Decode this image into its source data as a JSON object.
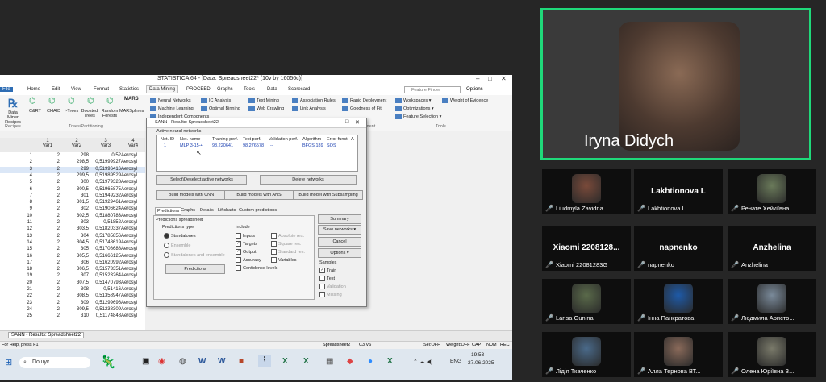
{
  "app": {
    "title": "STATISTICA 64 - [Data: Spreadsheet22* (10v by 16056c)]",
    "search_placeholder": "Feature Finder",
    "options_label": "Options"
  },
  "menu_tabs": [
    "File",
    "Home",
    "Edit",
    "View",
    "Format",
    "Statistics",
    "Data Mining",
    "PROCEED",
    "Graphs",
    "Tools",
    "Data",
    "Scorecard"
  ],
  "ribbon": {
    "recipes": {
      "label": "Data Miner Recipes",
      "group": "Recipes"
    },
    "trees": {
      "items": [
        "C&RT",
        "CHAID",
        "I-Trees",
        "Boosted Trees",
        "Random Forests",
        "MARSplines"
      ],
      "group": "Trees/Partitioning"
    },
    "col1": [
      "Neural Networks",
      "Machine Learning",
      "Independent Components"
    ],
    "col2": [
      "IC Analysis",
      "Optimal Binning"
    ],
    "col3": [
      "Text Mining",
      "Web Crawling"
    ],
    "col4": [
      "Association Rules",
      "Link Analysis"
    ],
    "col5": [
      "Rapid Deployment",
      "Goodness of Fit"
    ],
    "col6": [
      "Workspaces",
      "Optimizations",
      "Feature Selection"
    ],
    "col7": [
      "Weight of Evidence"
    ],
    "group_tools": "Tools",
    "group_ment": "ment"
  },
  "sheet": {
    "headers": [
      {
        "n": "1",
        "v": "Var1"
      },
      {
        "n": "2",
        "v": "Var2"
      },
      {
        "n": "3",
        "v": "Var3"
      },
      {
        "n": "4",
        "v": "Var4"
      }
    ],
    "rows": [
      [
        "1",
        "2",
        "298",
        "0,52",
        "Aerosyl"
      ],
      [
        "2",
        "2",
        "298,5",
        "0,51999927",
        "Aerosyl"
      ],
      [
        "3",
        "2",
        "299",
        "0,51996416",
        "Aerosyl"
      ],
      [
        "4",
        "2",
        "299,5",
        "0,51989529",
        "Aerosyl"
      ],
      [
        "5",
        "2",
        "300",
        "0,51979328",
        "Aerosyl"
      ],
      [
        "6",
        "2",
        "300,5",
        "0,51965875",
        "Aerosyl"
      ],
      [
        "7",
        "2",
        "301",
        "0,51949232",
        "Aerosyl"
      ],
      [
        "8",
        "2",
        "301,5",
        "0,51929461",
        "Aerosyl"
      ],
      [
        "9",
        "2",
        "302",
        "0,51906624",
        "Aerosyl"
      ],
      [
        "10",
        "2",
        "302,5",
        "0,51880783",
        "Aerosyl"
      ],
      [
        "11",
        "2",
        "303",
        "0,51852",
        "Aerosyl"
      ],
      [
        "12",
        "2",
        "303,5",
        "0,51820337",
        "Aerosyl"
      ],
      [
        "13",
        "2",
        "304",
        "0,51785856",
        "Aerosyl"
      ],
      [
        "14",
        "2",
        "304,5",
        "0,51748619",
        "Aerosyl"
      ],
      [
        "15",
        "2",
        "305",
        "0,51708688",
        "Aerosyl"
      ],
      [
        "16",
        "2",
        "305,5",
        "0,51666125",
        "Aerosyl"
      ],
      [
        "17",
        "2",
        "306",
        "0,51620992",
        "Aerosyl"
      ],
      [
        "18",
        "2",
        "306,5",
        "0,51573351",
        "Aerosyl"
      ],
      [
        "19",
        "2",
        "307",
        "0,51523264",
        "Aerosyl"
      ],
      [
        "20",
        "2",
        "307,5",
        "0,51470793",
        "Aerosyl"
      ],
      [
        "21",
        "2",
        "308",
        "0,51416",
        "Aerosyl"
      ],
      [
        "22",
        "2",
        "308,5",
        "0,51358947",
        "Aerosyl"
      ],
      [
        "23",
        "2",
        "309",
        "0,51299696",
        "Aerosyl"
      ],
      [
        "24",
        "2",
        "309,5",
        "0,51238309",
        "Aerosyl"
      ],
      [
        "25",
        "2",
        "310",
        "0,51174848",
        "Aerosyl"
      ]
    ]
  },
  "dialog": {
    "title": "SANN - Results: Spreadsheet22",
    "section": "Active neural networks",
    "table_headers": [
      "Net. ID",
      "Net. name",
      "Training perf.",
      "Test perf.",
      "Validation perf.",
      "Algorithm",
      "Error funct.",
      "A"
    ],
    "row": [
      "1",
      "MLP 3-15-4",
      "98,220641",
      "98,276578",
      "--",
      "BFGS 189",
      "SOS"
    ],
    "select_btn": "Select\\Deselect active networks",
    "delete_btn": "Delete networks",
    "build_cnn": "Build models with CNN",
    "build_ans": "Build  models with ANS",
    "build_sub": "Build model with Subsampling",
    "tabs": [
      "Predictions",
      "Graphs",
      "Details",
      "Liftcharts",
      "Custom predictions"
    ],
    "pred_spreadsheet": "Predictions spreadsheet",
    "pred_type": "Predictions type",
    "radios": [
      "Standalones",
      "Ensemble",
      "Standalones and ensemble"
    ],
    "include": "Include",
    "inc_left": [
      "Inputs",
      "Targets",
      "Output",
      "Accuracy",
      "Confidence levels"
    ],
    "inc_right": [
      "Absolute res.",
      "Square res.",
      "Standard res.",
      "Variables"
    ],
    "pred_btn": "Predictions",
    "summary_btn": "Summary",
    "save_btn": "Save networks",
    "cancel_btn": "Cancel",
    "options_btn": "Options",
    "samples": "Samples",
    "samples_list": [
      "Train",
      "Test",
      "Validation",
      "Missing"
    ]
  },
  "statusbar": {
    "help": "For Help, press F1",
    "doc": "SANN - Results: Spreadsheet22",
    "cells": [
      "Spreadsheet2",
      "C3,V6",
      "Sel:OFF",
      "Weight:OFF",
      "CAP",
      "NUM",
      "REC"
    ]
  },
  "taskbar": {
    "search": "Пошук",
    "time": "19:53",
    "date": "27.06.2025",
    "lang": "ENG"
  },
  "participants": {
    "main": "Iryna Didych",
    "tiles": [
      {
        "label": "Liudmyla Zavidna",
        "big": ""
      },
      {
        "label": "Lakhtionova L",
        "big": "Lakhtionova L"
      },
      {
        "label": "Ренате Хейкіївна ...",
        "big": ""
      },
      {
        "label": "Xiaomi 22081283G",
        "big": "Xiaomi 2208128..."
      },
      {
        "label": "napnenko",
        "big": "napnenko"
      },
      {
        "label": "Anzhelina",
        "big": "Anzhelina"
      },
      {
        "label": "Larisa Gunina",
        "big": ""
      },
      {
        "label": "Інна Панкратова",
        "big": ""
      },
      {
        "label": "Людмила Аристо...",
        "big": ""
      },
      {
        "label": "Лідія Ткаченко",
        "big": ""
      },
      {
        "label": "Алла Тернова ВТ...",
        "big": ""
      },
      {
        "label": "Олена Юріївна З...",
        "big": ""
      }
    ]
  },
  "colors": {
    "accent": "#2ecc71",
    "speaker_border": "#1fd97a",
    "mic_muted": "#e03a3a",
    "statistica_blue": "#4a7fc1"
  }
}
